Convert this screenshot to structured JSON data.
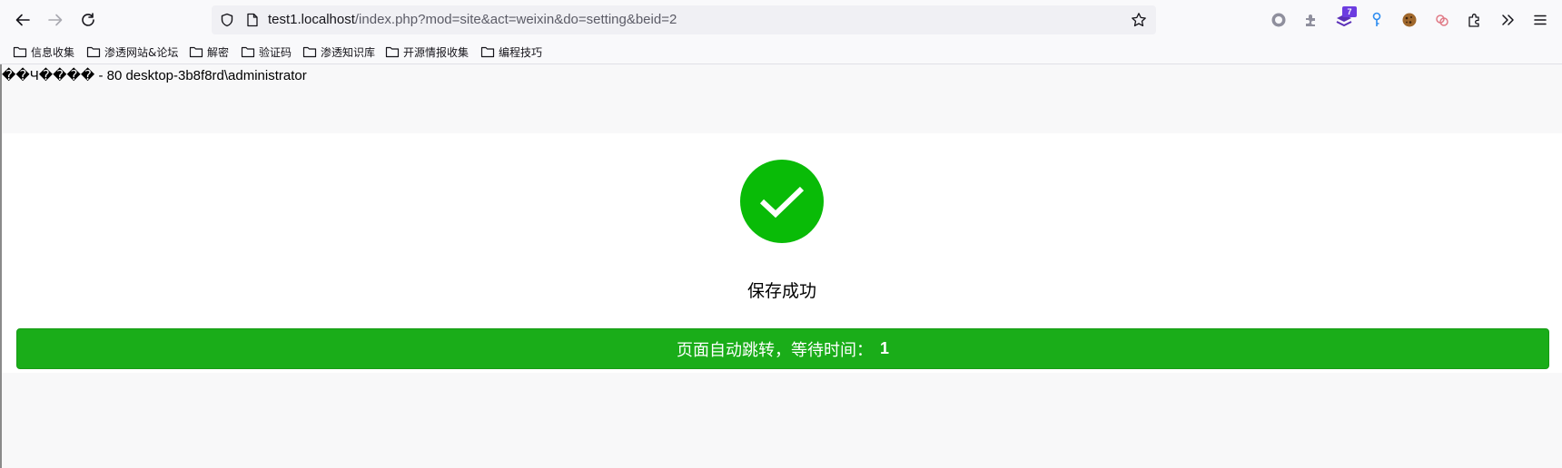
{
  "browser": {
    "url_host": "test1.localhost",
    "url_path": "/index.php?mod=site&act=weixin&do=setting&beid=2",
    "extensions": [
      {
        "icon": "record-icon"
      },
      {
        "icon": "puzzle-addon-icon"
      },
      {
        "icon": "hackbar-icon",
        "badge": "7"
      },
      {
        "icon": "key-pin-icon"
      },
      {
        "icon": "cookie-icon"
      },
      {
        "icon": "link-circles-icon"
      },
      {
        "icon": "extensions-icon"
      },
      {
        "icon": "overflow-chevrons-icon"
      },
      {
        "icon": "hamburger-menu-icon"
      }
    ]
  },
  "bookmarks": [
    "信息收集",
    "渗透网站&论坛",
    "解密",
    "验证码",
    "渗透知识库",
    "开源情报收集",
    "编程技巧"
  ],
  "page": {
    "echo_text": "��Ч���� - 80 desktop-3b8f8rd\\administrator",
    "message": "保存成功",
    "redirect_label": "页面自动跳转，等待时间：",
    "countdown": "1"
  },
  "colors": {
    "success_green": "#09bb07",
    "button_green": "#1aad19"
  }
}
